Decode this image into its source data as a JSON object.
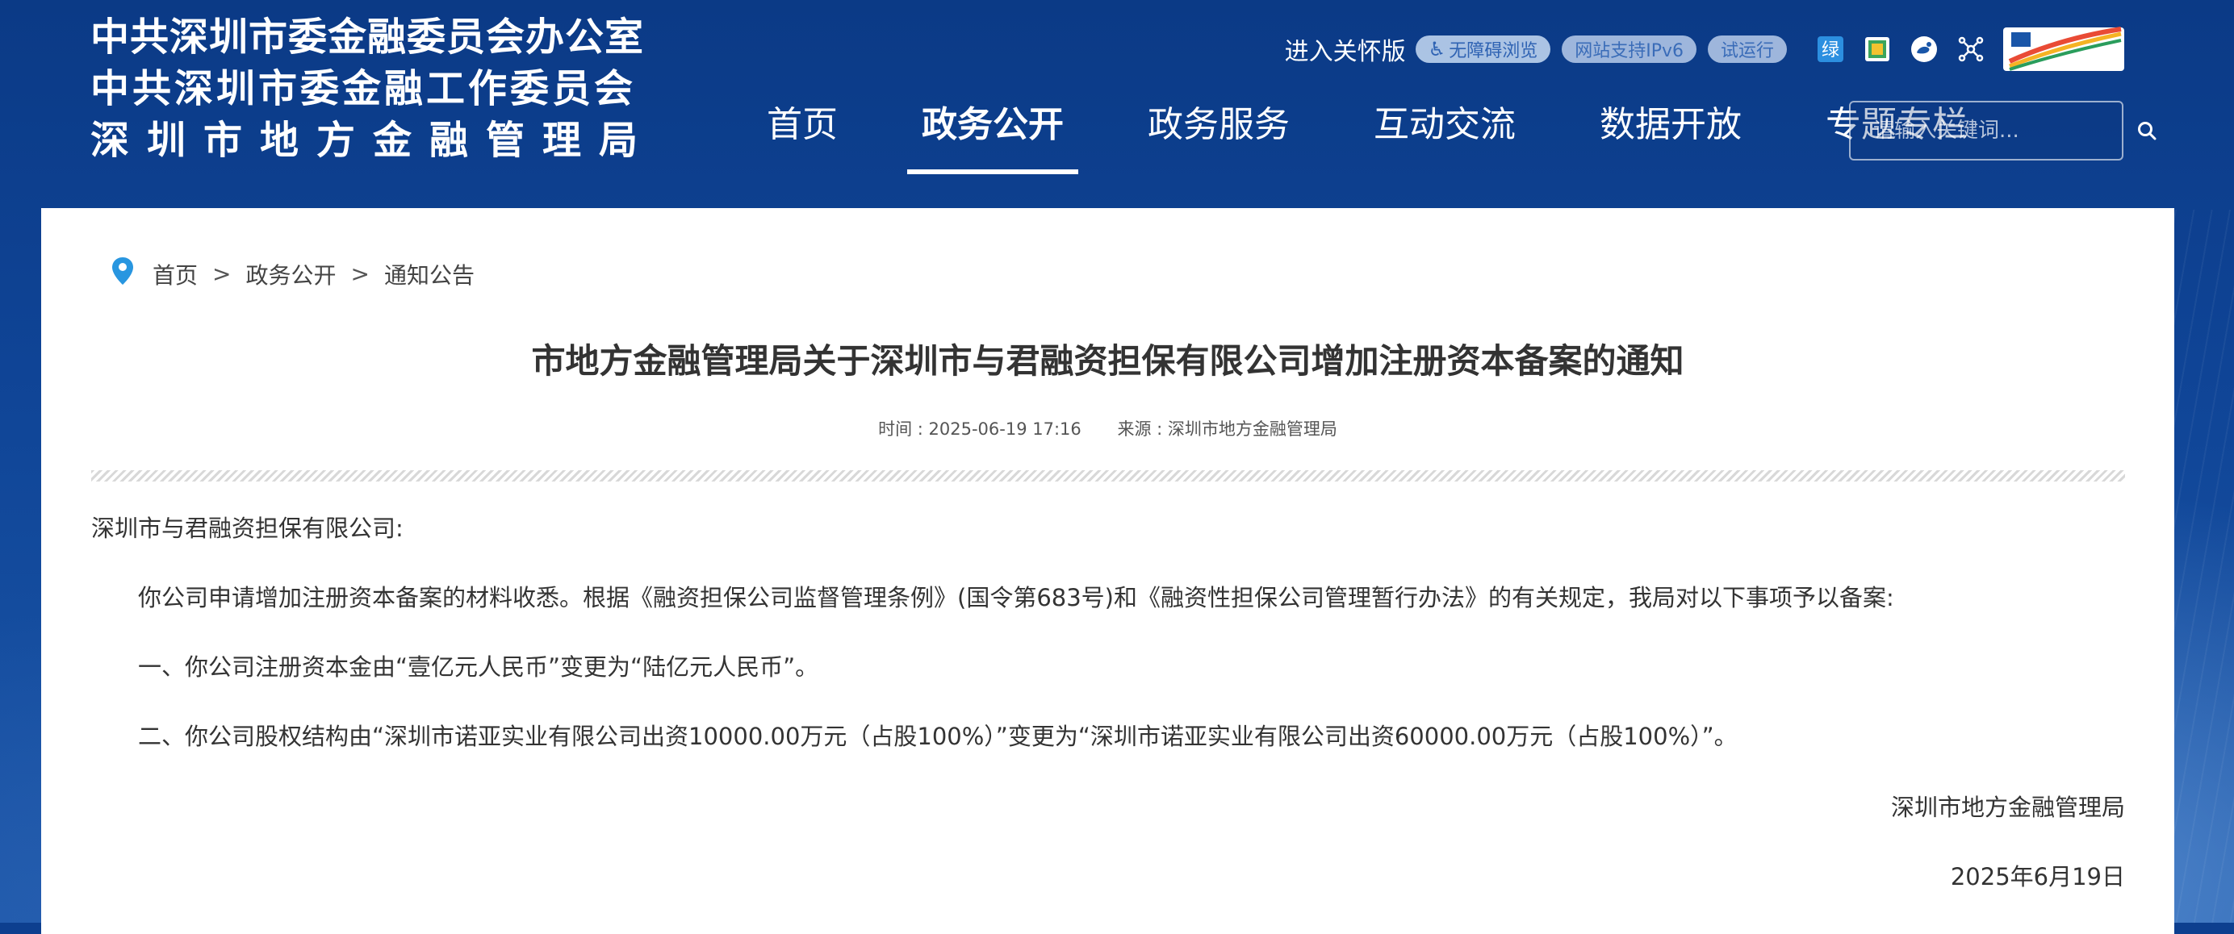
{
  "header": {
    "org_names": [
      "中共深圳市委金融委员会办公室",
      "中共深圳市委金融工作委员会",
      "深圳市地方金融管理局"
    ],
    "care_mode": "进入关怀版",
    "accessibility_pill": "无障碍浏览",
    "ipv6_pill": "网站支持IPv6",
    "trial_pill": "试运行",
    "nav": [
      {
        "label": "首页"
      },
      {
        "label": "政务公开",
        "active": true
      },
      {
        "label": "政务服务"
      },
      {
        "label": "互动交流"
      },
      {
        "label": "数据开放"
      },
      {
        "label": "专题专栏"
      }
    ],
    "search_placeholder": "请输入关键词...",
    "tool_icons": [
      "green-channel-icon",
      "mini-program-icon",
      "weibo-icon",
      "network-share-icon",
      "shenzhen-china-logo"
    ],
    "colors": {
      "header_blue": "#0d3f8f",
      "pill_bg": "#c8dcf5",
      "pill_text": "#2f63b3"
    }
  },
  "breadcrumb": [
    "首页",
    "政务公开",
    "通知公告"
  ],
  "breadcrumb_sep": ">",
  "article": {
    "title": "市地方金融管理局关于深圳市与君融资担保有限公司增加注册资本备案的通知",
    "time_label": "时间 : 2025-06-19 17:16",
    "source_label": "来源 : 深圳市地方金融管理局",
    "salutation": "深圳市与君融资担保有限公司:",
    "paragraphs": [
      "你公司申请增加注册资本备案的材料收悉。根据《融资担保公司监督管理条例》(国令第683号)和《融资性担保公司管理暂行办法》的有关规定，我局对以下事项予以备案:",
      "一、你公司注册资本金由“壹亿元人民币”变更为“陆亿元人民币”。",
      "二、你公司股权结构由“深圳市诺亚实业有限公司出资10000.00万元（占股100%）”变更为“深圳市诺亚实业有限公司出资60000.00万元（占股100%）”。"
    ],
    "signature": "深圳市地方金融管理局",
    "date": "2025年6月19日"
  }
}
